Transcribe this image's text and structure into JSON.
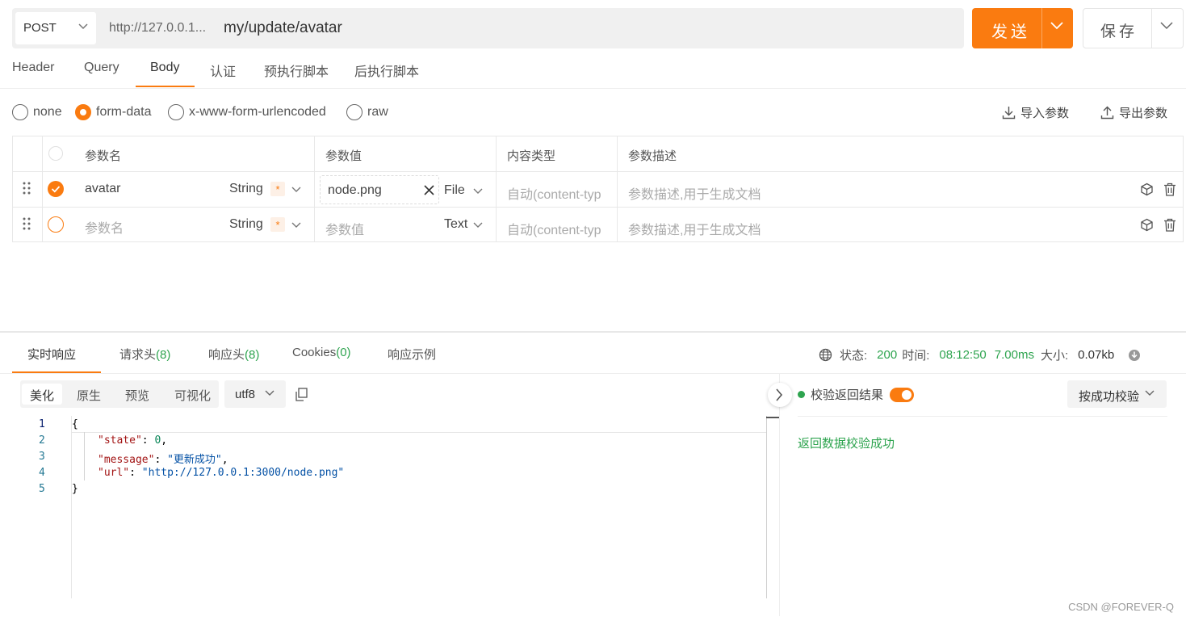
{
  "request": {
    "method": "POST",
    "url_base": "http://127.0.0.1...",
    "url_path": "my/update/avatar",
    "send_label": "发送",
    "save_label": "保存"
  },
  "tabs": [
    {
      "label": "Header"
    },
    {
      "label": "Query"
    },
    {
      "label": "Body",
      "active": true
    },
    {
      "label": "认证"
    },
    {
      "label": "预执行脚本"
    },
    {
      "label": "后执行脚本"
    }
  ],
  "body_types": [
    {
      "label": "none"
    },
    {
      "label": "form-data",
      "selected": true
    },
    {
      "label": "x-www-form-urlencoded"
    },
    {
      "label": "raw"
    }
  ],
  "tools": {
    "import": "导入参数",
    "export": "导出参数"
  },
  "table": {
    "headers": {
      "name": "参数名",
      "value": "参数值",
      "content_type": "内容类型",
      "desc": "参数描述"
    },
    "rows": [
      {
        "checked": true,
        "name": "avatar",
        "type": "String",
        "required": "*",
        "value": "node.png",
        "value_kind": "File",
        "content_type": "自动(content-typ",
        "desc": "参数描述,用于生成文档"
      },
      {
        "checked": false,
        "name": "参数名",
        "type": "String",
        "required": "*",
        "value": "参数值",
        "value_kind": "Text",
        "content_type": "自动(content-typ",
        "desc": "参数描述,用于生成文档"
      }
    ]
  },
  "response": {
    "tabs": [
      {
        "label": "实时响应",
        "active": true
      },
      {
        "label": "请求头",
        "count": "(8)"
      },
      {
        "label": "响应头",
        "count": "(8)"
      },
      {
        "label": "Cookies",
        "count": "(0)"
      },
      {
        "label": "响应示例"
      }
    ],
    "status_label": "状态:",
    "status": "200",
    "time_label": "时间:",
    "time": "08:12:50",
    "duration": "7.00ms",
    "size_label": "大小:",
    "size": "0.07kb",
    "views": [
      "美化",
      "原生",
      "预览",
      "可视化"
    ],
    "encoding": "utf8",
    "line_numbers": [
      "1",
      "2",
      "3",
      "4",
      "5"
    ],
    "json": {
      "open": "{",
      "state_key": "\"state\"",
      "state_val": "0",
      "message_key": "\"message\"",
      "message_val": "\"更新成功\"",
      "url_key": "\"url\"",
      "url_val": "\"http://127.0.0.1:3000/node.png\"",
      "close": "}"
    }
  },
  "validation": {
    "label": "校验返回结果",
    "mode": "按成功校验",
    "result": "返回数据校验成功"
  },
  "watermark": "CSDN @FOREVER-Q",
  "colors": {
    "accent": "#fa7b10",
    "success": "#2ea44f"
  }
}
